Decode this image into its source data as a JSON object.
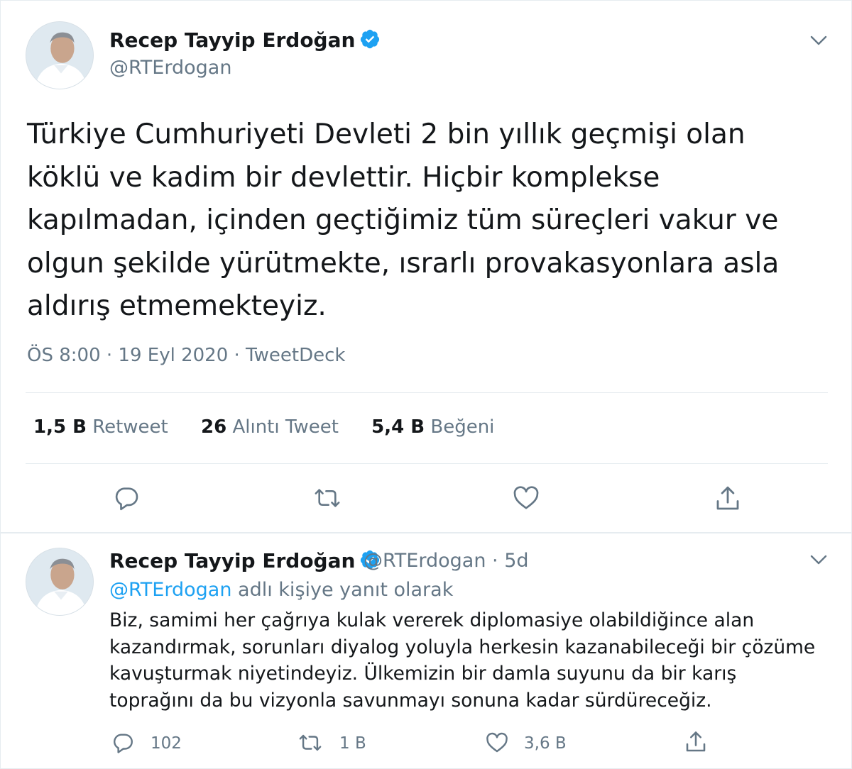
{
  "main_tweet": {
    "display_name": "Recep Tayyip Erdoğan",
    "handle": "@RTErdogan",
    "text": "Türkiye Cumhuriyeti Devleti 2 bin yıllık geçmişi olan köklü ve kadim bir devlettir. Hiçbir komplekse kapılmadan, içinden geçtiğimiz tüm süreçleri vakur ve olgun şekilde yürütmekte, ısrarlı provakasyonlara asla aldırış etmemekteyiz.",
    "time": "ÖS 8:00",
    "date": "19 Eyl 2020",
    "source": "TweetDeck",
    "separator": "·",
    "stats": {
      "retweets": {
        "count": "1,5 B",
        "label": "Retweet"
      },
      "quotes": {
        "count": "26",
        "label": "Alıntı Tweet"
      },
      "likes": {
        "count": "5,4 B",
        "label": "Beğeni"
      }
    },
    "actions": [
      "reply-icon",
      "retweet-icon",
      "like-icon",
      "share-icon"
    ]
  },
  "reply_tweet": {
    "display_name": "Recep Tayyip Erdoğan",
    "handle": "@RTErdogan",
    "separator": "·",
    "age": "5d",
    "replying_to_mention": "@RTErdogan",
    "replying_to_suffix": "adlı kişiye yanıt olarak",
    "text": "Biz, samimi her çağrıya kulak vererek diplomasiye olabildiğince alan kazandırmak, sorunları diyalog yoluyla herkesin kazanabileceği bir çözüme kavuşturmak niyetindeyiz. Ülkemizin bir damla suyunu da bir karış toprağını da bu vizyonla savunmayı sonuna kadar sürdüreceğiz.",
    "counts": {
      "replies": "102",
      "retweets": "1 B",
      "likes": "3,6 B"
    }
  },
  "colors": {
    "text": "#14171a",
    "secondary": "#657786",
    "link": "#1da1f2",
    "verified": "#1da1f2",
    "divider": "#e6ecf0"
  }
}
